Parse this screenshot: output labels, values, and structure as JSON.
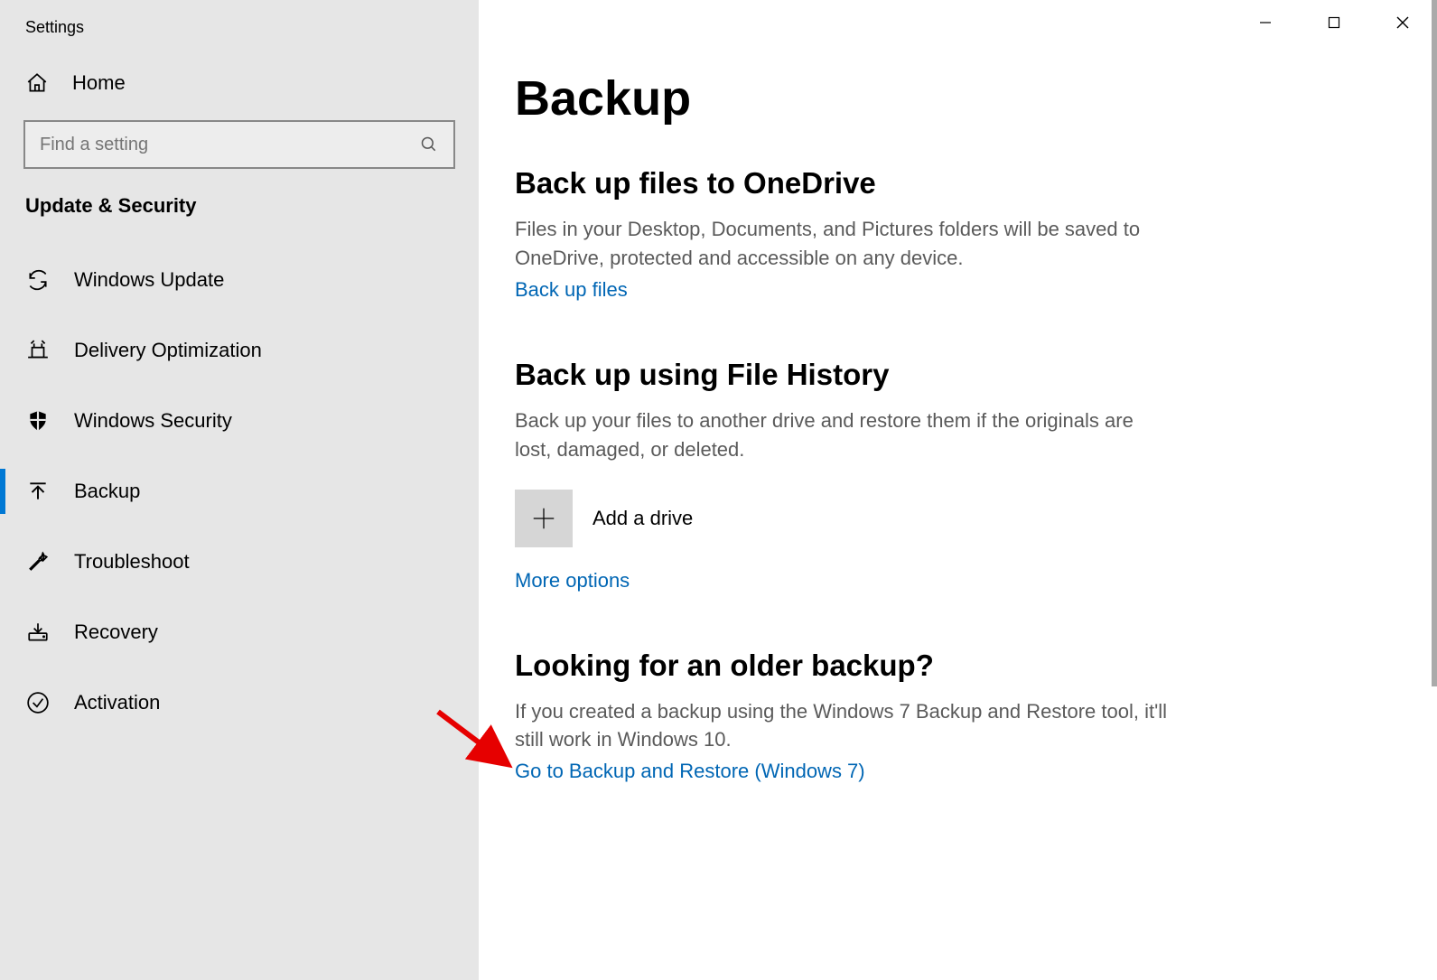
{
  "app": {
    "title": "Settings"
  },
  "sidebar": {
    "home_label": "Home",
    "search_placeholder": "Find a setting",
    "category_title": "Update & Security",
    "items": [
      {
        "label": "Windows Update",
        "icon": "sync-icon",
        "selected": false
      },
      {
        "label": "Delivery Optimization",
        "icon": "delivery-icon",
        "selected": false
      },
      {
        "label": "Windows Security",
        "icon": "shield-icon",
        "selected": false
      },
      {
        "label": "Backup",
        "icon": "backup-arrow-icon",
        "selected": true
      },
      {
        "label": "Troubleshoot",
        "icon": "wrench-icon",
        "selected": false
      },
      {
        "label": "Recovery",
        "icon": "recovery-icon",
        "selected": false
      },
      {
        "label": "Activation",
        "icon": "checkmark-circle-icon",
        "selected": false
      }
    ]
  },
  "main": {
    "page_title": "Backup",
    "sections": [
      {
        "title": "Back up files to OneDrive",
        "desc": "Files in your Desktop, Documents, and Pictures folders will be saved to OneDrive, protected and accessible on any device.",
        "link": "Back up files"
      },
      {
        "title": "Back up using File History",
        "desc": "Back up your files to another drive and restore them if the originals are lost, damaged, or deleted.",
        "add_drive_label": "Add a drive",
        "link": "More options"
      },
      {
        "title": "Looking for an older backup?",
        "desc": "If you created a backup using the Windows 7 Backup and Restore tool, it'll still work in Windows 10.",
        "link": "Go to Backup and Restore (Windows 7)"
      }
    ]
  }
}
